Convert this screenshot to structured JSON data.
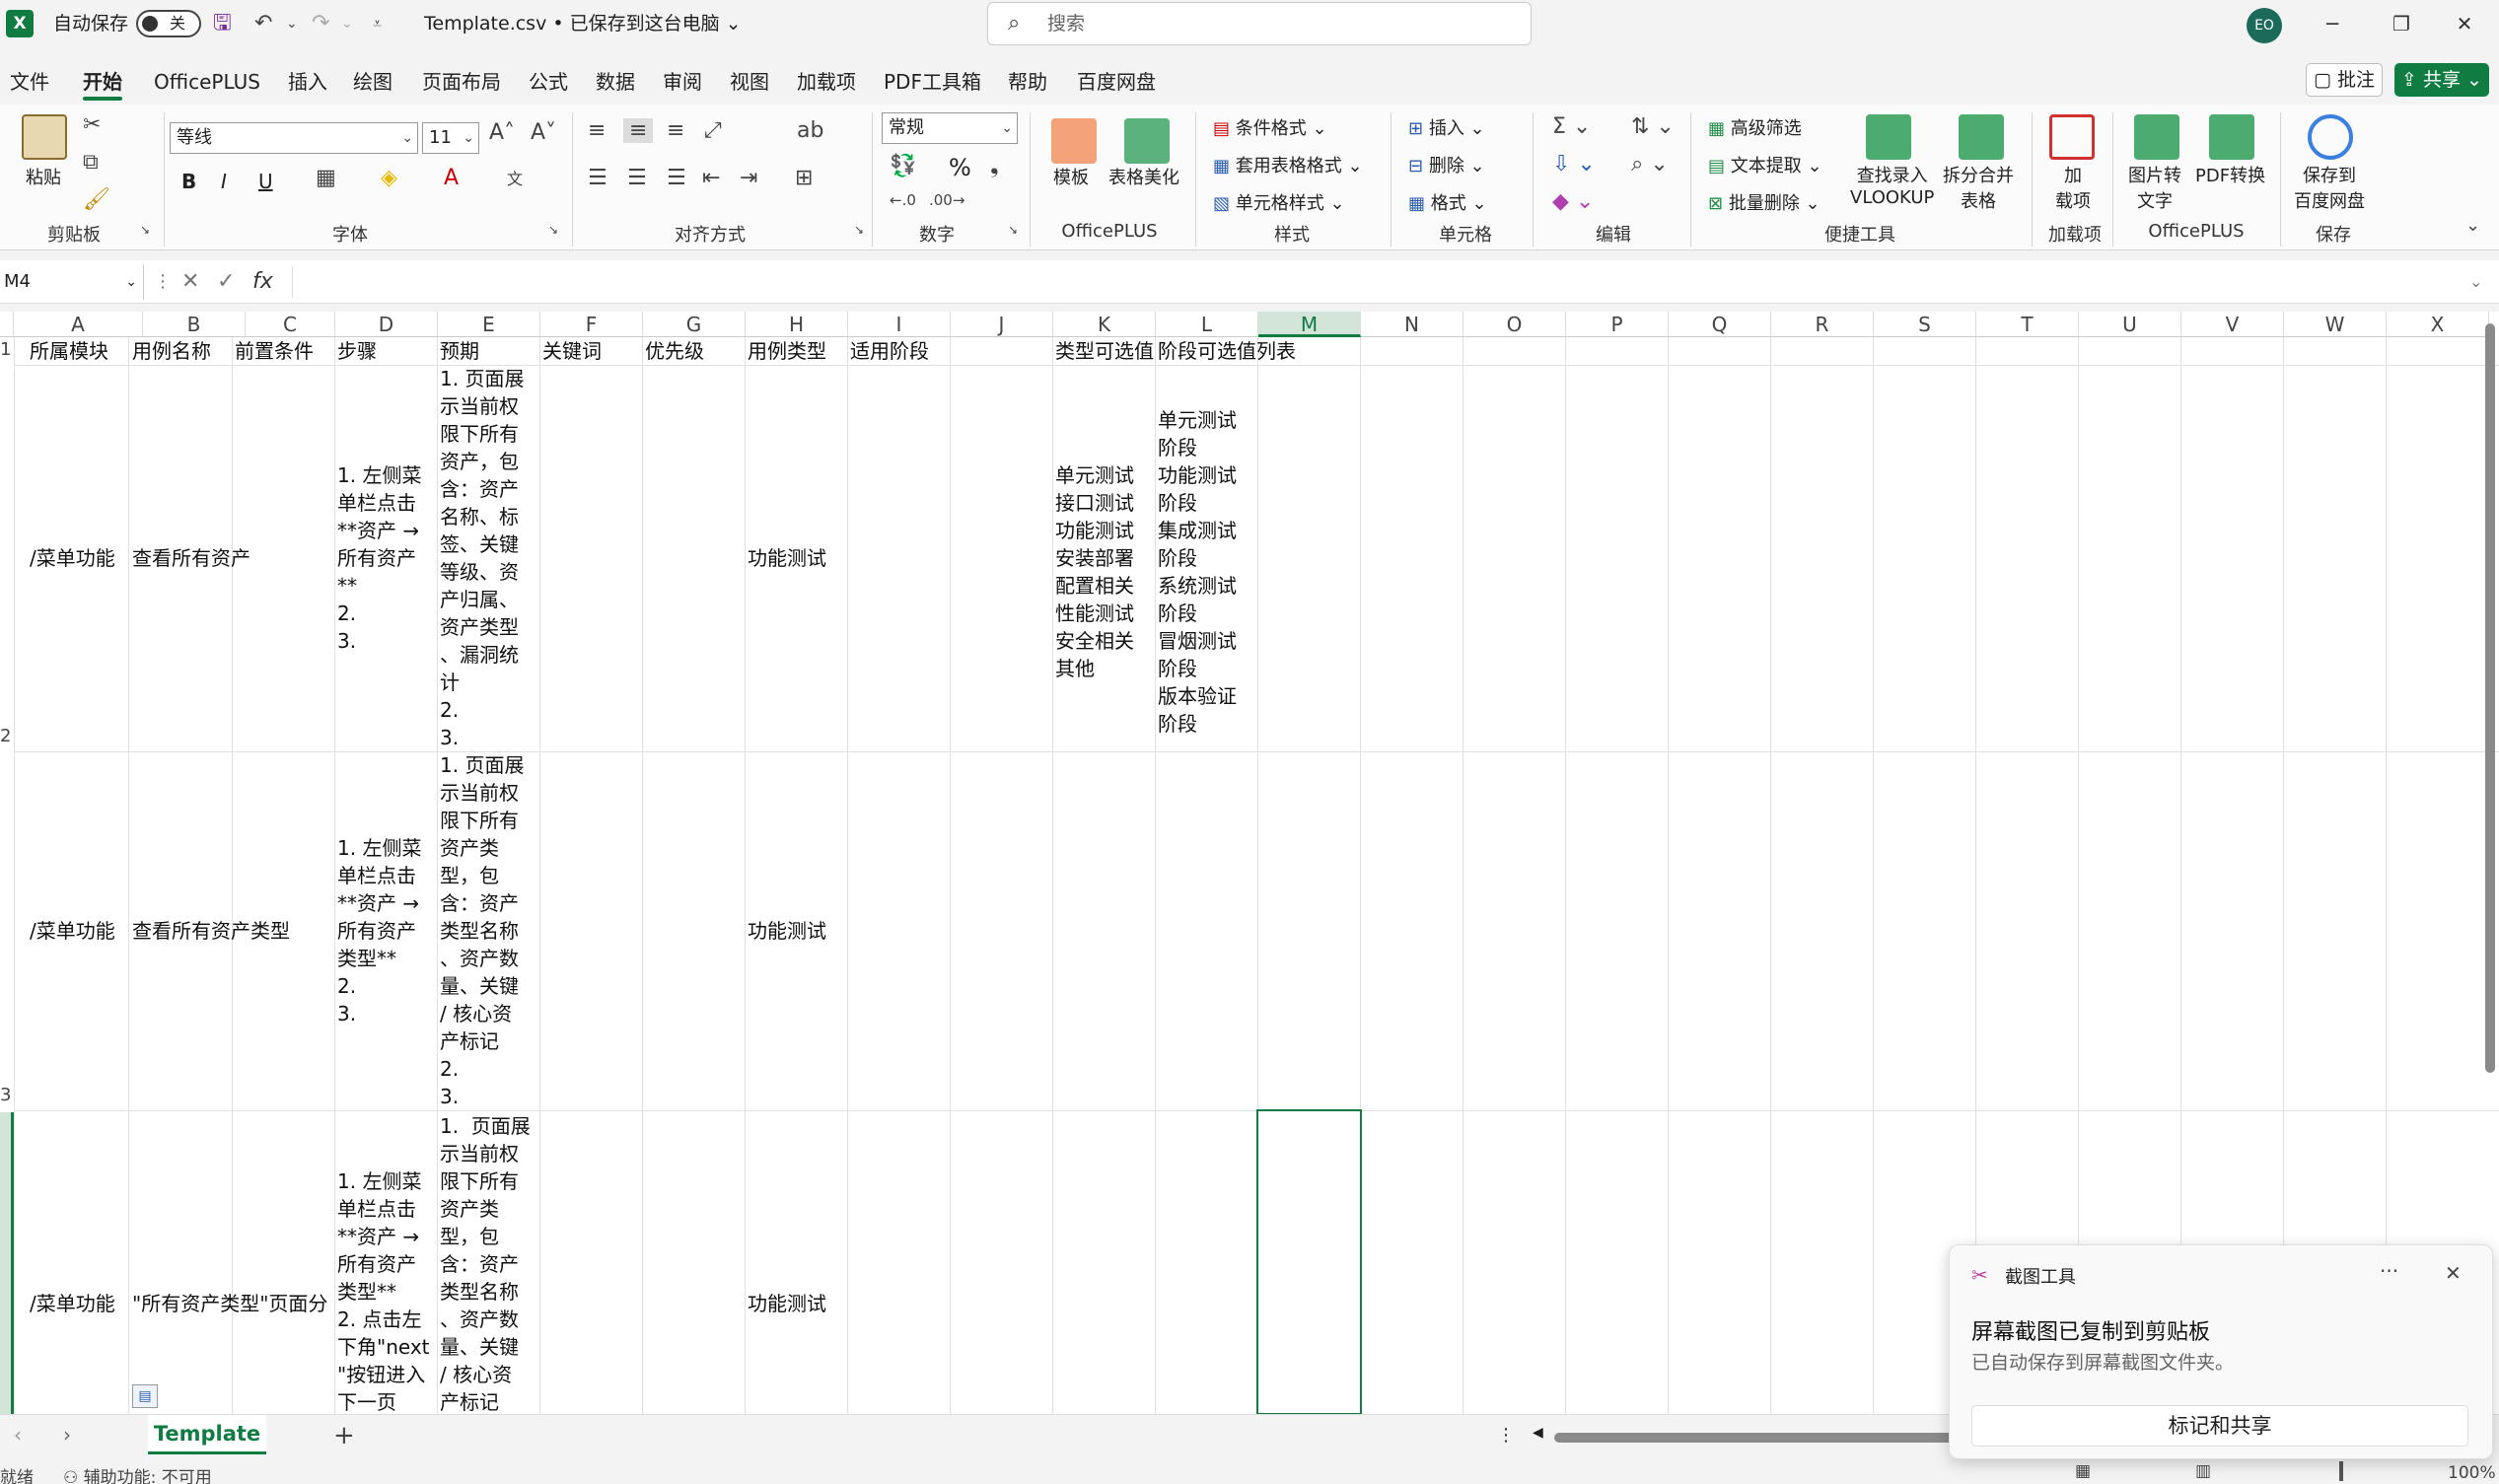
{
  "titlebar": {
    "autosave_label": "自动保存",
    "autosave_state": "关",
    "filename": "Template.csv • 已保存到这台电脑",
    "filename_chevron": "⌄",
    "search_placeholder": "搜索",
    "avatar_initials": "EO",
    "minimize": "─",
    "restore": "❐",
    "close": "✕"
  },
  "menus": [
    "文件",
    "开始",
    "OfficePLUS",
    "插入",
    "绘图",
    "页面布局",
    "公式",
    "数据",
    "审阅",
    "视图",
    "加载项",
    "PDF工具箱",
    "帮助",
    "百度网盘"
  ],
  "menu_active_index": 1,
  "comment_button": "批注",
  "share_button": "共享",
  "ribbon": {
    "groups": [
      "剪贴板",
      "字体",
      "对齐方式",
      "数字",
      "OfficePLUS",
      "样式",
      "单元格",
      "编辑",
      "便捷工具",
      "加载项",
      "OfficePLUS",
      "保存"
    ],
    "paste": "粘贴",
    "font_name": "等线",
    "font_size": "11",
    "number_format": "常规",
    "template": "模板",
    "table_beautify": "表格美化",
    "cond_format": "条件格式",
    "table_format": "套用表格格式",
    "cell_style": "单元格样式",
    "insert": "插入",
    "delete": "删除",
    "format": "格式",
    "adv_filter": "高级筛选",
    "text_extract": "文本提取",
    "batch_delete": "批量删除",
    "vlookup_line1": "查找录入",
    "vlookup_line2": "VLOOKUP",
    "split_merge_line1": "拆分合并",
    "split_merge_line2": "表格",
    "addin_line1": "加",
    "addin_line2": "载项",
    "img2text_line1": "图片转",
    "img2text_line2": "文字",
    "pdf_convert": "PDF转换",
    "save_baidu_line1": "保存到",
    "save_baidu_line2": "百度网盘",
    "bold": "B",
    "italic": "I",
    "underline": "U",
    "percent": "%"
  },
  "formula_bar": {
    "name_box": "M4",
    "fx": "fx",
    "content": ""
  },
  "columns": [
    "A",
    "B",
    "C",
    "D",
    "E",
    "F",
    "G",
    "H",
    "I",
    "J",
    "K",
    "L",
    "M",
    "N",
    "O",
    "P",
    "Q",
    "R",
    "S",
    "T",
    "U",
    "V",
    "W",
    "X"
  ],
  "selected_column": "M",
  "row_numbers": [
    "1",
    "2",
    "3"
  ],
  "header_row": [
    "所属模块",
    "用例名称",
    "前置条件",
    "步骤",
    "预期",
    "关键词",
    "优先级",
    "用例类型",
    "适用阶段",
    "",
    "类型可选值",
    "阶段可选值列表"
  ],
  "rows": [
    {
      "module": "/菜单功能",
      "name": "查看所有资产",
      "steps": "1. 左侧菜\n单栏点击\n**资产 →\n所有资产\n**\n2.\n3.",
      "expected": "1. 页面展\n示当前权\n限下所有\n资产，包\n含：资产\n名称、标\n签、关键\n等级、资\n产归属、\n资产类型\n、漏洞统\n计\n2.\n3.",
      "type": "功能测试",
      "type_options": "单元测试\n接口测试\n功能测试\n安装部署\n配置相关\n性能测试\n安全相关\n其他",
      "stage_options": "单元测试\n阶段\n功能测试\n阶段\n集成测试\n阶段\n系统测试\n阶段\n冒烟测试\n阶段\n版本验证\n阶段"
    },
    {
      "module": "/菜单功能",
      "name": "查看所有资产类型",
      "steps": "1. 左侧菜\n单栏点击\n**资产 →\n所有资产\n类型**\n2.\n3.",
      "expected": "1. 页面展\n示当前权\n限下所有\n资产类\n型，包\n含：资产\n类型名称\n、资产数\n量、关键\n/ 核心资\n产标记\n2.\n3.",
      "type": "功能测试",
      "type_options": "",
      "stage_options": ""
    },
    {
      "module": "/菜单功能",
      "name": "\"所有资产类型\"页面分",
      "steps": "1. 左侧菜\n单栏点击\n**资产 →\n所有资产\n类型**\n2. 点击左\n下角\"next\n\"按钮进入\n下一页",
      "expected": "1.  页面展\n示当前权\n限下所有\n资产类\n型，包\n含：资产\n类型名称\n、资产数\n量、关键\n/ 核心资\n产标记",
      "type": "功能测试",
      "type_options": "",
      "stage_options": ""
    }
  ],
  "sheet_tab": "Template",
  "add_sheet": "+",
  "status": {
    "ready": "就绪",
    "accessibility": "辅助功能: 不可用",
    "zoom": "100%"
  },
  "toast": {
    "app": "截图工具",
    "more": "···",
    "close": "✕",
    "heading": "屏幕截图已复制到剪贴板",
    "body": "已自动保存到屏幕截图文件夹。",
    "action": "标记和共享"
  },
  "colors": {
    "accent": "#107c41"
  }
}
